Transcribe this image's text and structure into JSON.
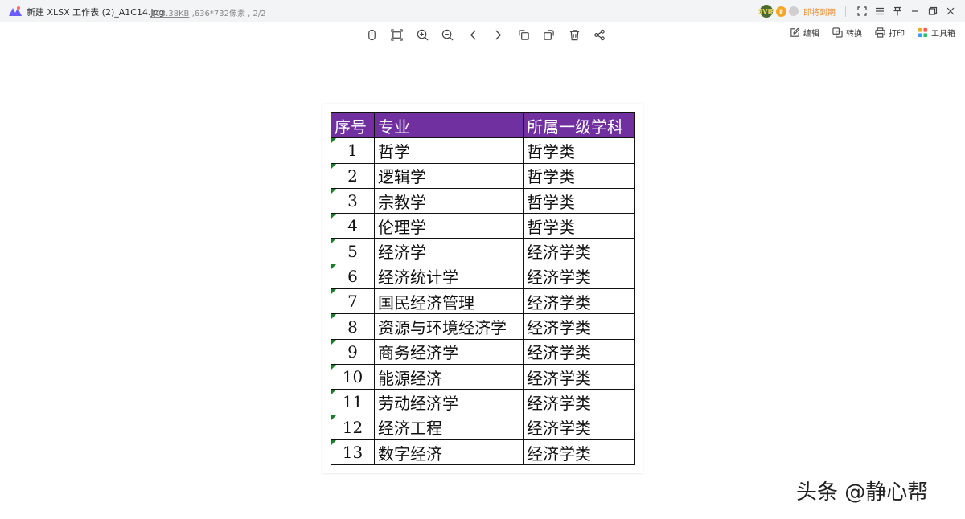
{
  "titlebar": {
    "file_name": "新建 XLSX 工作表 (2)_A1C14.jpg",
    "file_size": "103.38KB",
    "file_dims": " ,636*732像素 , 2/2",
    "badge_vip": "SVIP",
    "expiry_text": "即将到期"
  },
  "toolbar": {
    "icons": [
      "mouse-icon",
      "fit-screen-icon",
      "zoom-in-icon",
      "zoom-out-icon",
      "prev-icon",
      "next-icon",
      "rotate-left-icon",
      "rotate-right-icon",
      "delete-icon",
      "share-icon"
    ]
  },
  "actions": {
    "edit": "编辑",
    "convert": "转换",
    "print": "打印",
    "toolbox": "工具箱"
  },
  "sheet": {
    "headers": [
      "序号",
      "专业",
      "所属一级学科"
    ],
    "header_color": "#7030a0",
    "rows": [
      [
        "1",
        "哲学",
        "哲学类"
      ],
      [
        "2",
        "逻辑学",
        "哲学类"
      ],
      [
        "3",
        "宗教学",
        "哲学类"
      ],
      [
        "4",
        "伦理学",
        "哲学类"
      ],
      [
        "5",
        "经济学",
        "经济学类"
      ],
      [
        "6",
        "经济统计学",
        "经济学类"
      ],
      [
        "7",
        "国民经济管理",
        "经济学类"
      ],
      [
        "8",
        "资源与环境经济学",
        "经济学类"
      ],
      [
        "9",
        "商务经济学",
        "经济学类"
      ],
      [
        "10",
        "能源经济",
        "经济学类"
      ],
      [
        "11",
        "劳动经济学",
        "经济学类"
      ],
      [
        "12",
        "经济工程",
        "经济学类"
      ],
      [
        "13",
        "数字经济",
        "经济学类"
      ]
    ]
  },
  "watermark": "头条 @静心帮"
}
